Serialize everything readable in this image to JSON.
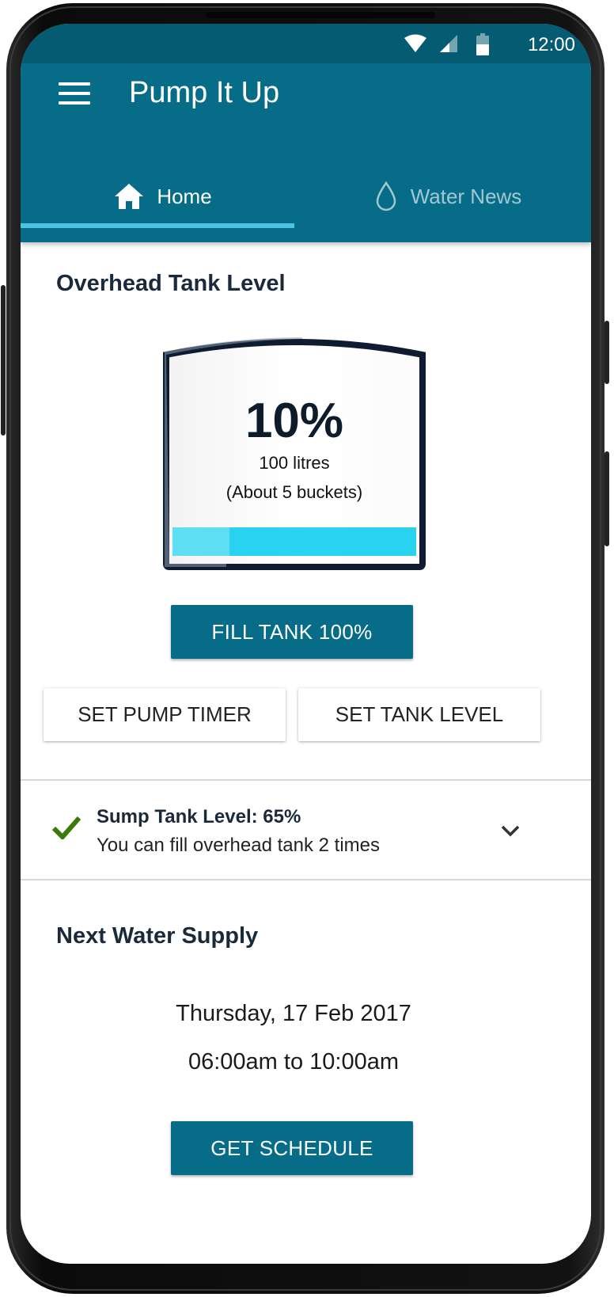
{
  "status": {
    "time": "12:00"
  },
  "app": {
    "title": "Pump It Up"
  },
  "tabs": [
    {
      "label": "Home",
      "icon": "home-icon",
      "active": true
    },
    {
      "label": "Water News",
      "icon": "water-drop-icon",
      "active": false
    }
  ],
  "overhead": {
    "title": "Overhead Tank Level",
    "percent_label": "10%",
    "level_fraction": 0.1,
    "litres": "100 litres",
    "buckets": "(About 5 buckets)"
  },
  "buttons": {
    "fill": "FILL TANK 100%",
    "timer": "SET PUMP TIMER",
    "tank_level": "SET TANK LEVEL",
    "schedule": "GET SCHEDULE"
  },
  "sump": {
    "title": "Sump Tank Level: 65%",
    "subtitle": "You can fill overhead tank 2 times"
  },
  "supply": {
    "title": "Next Water Supply",
    "date": "Thursday, 17 Feb 2017",
    "time": "06:00am to 10:00am"
  },
  "colors": {
    "primary": "#066c88",
    "status_bar": "#055b72",
    "tab_indicator": "#4fc3e3",
    "water": "#29d3ef",
    "check": "#3d7a0c"
  }
}
